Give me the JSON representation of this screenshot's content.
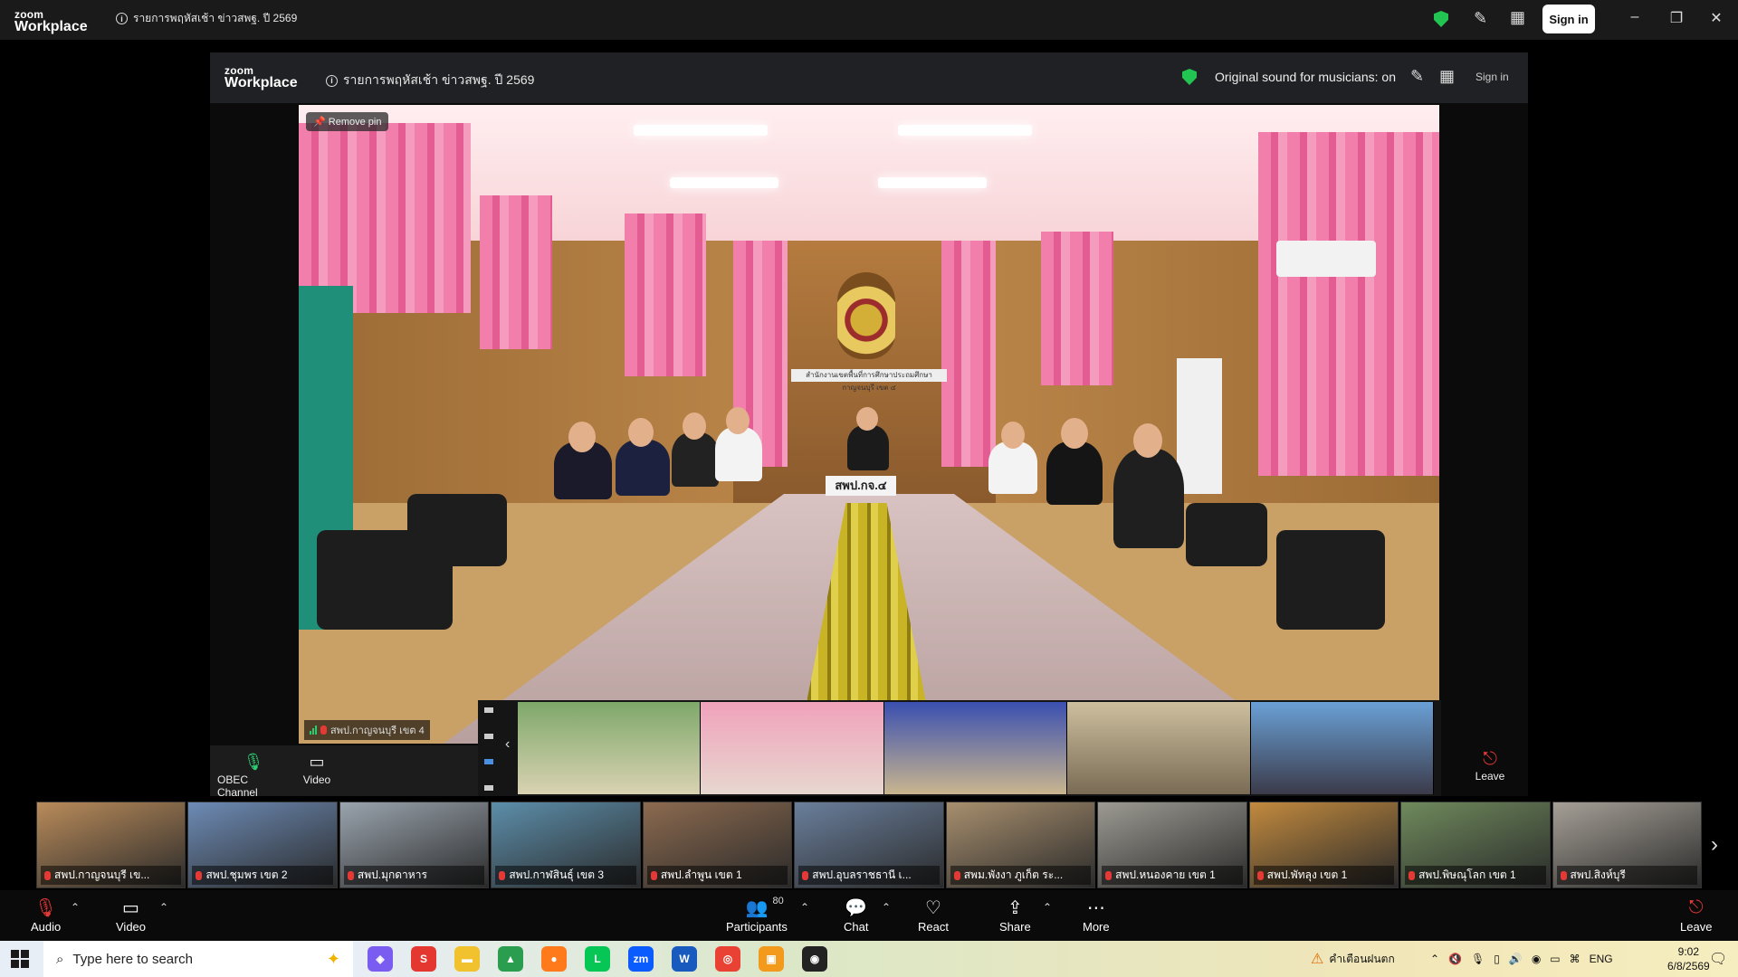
{
  "app": {
    "brand_top": "zoom",
    "brand_bottom": "Workplace"
  },
  "meeting": {
    "title": "รายการพฤหัสเช้า ข่าวสพฐ. ปี 2569"
  },
  "window": {
    "sign_in": "Sign in"
  },
  "shared_screen": {
    "original_sound": "Original sound for musicians: on",
    "sign_in": "Sign in",
    "remove_pin": "Remove pin",
    "video_name": "สพป.กาญจนบุรี เขต 4",
    "room_sign": "สำนักงานเขตพื้นที่การศึกษาประถมศึกษากาญจนบุรี เขต ๔",
    "nameplate": "สพป.กจ.๔",
    "inner_audio_label": "OBEC Channel",
    "inner_video_label": "Video",
    "inner_leave_label": "Leave"
  },
  "gallery": {
    "tiles": [
      {
        "name": "สพป.กาญจนบุรี เข...",
        "bg": "#b98b5a"
      },
      {
        "name": "สพป.ชุมพร เขต 2",
        "bg": "#6d8bb5"
      },
      {
        "name": "สพป.มุกดาหาร",
        "bg": "#9aa4ae"
      },
      {
        "name": "สพป.กาฬสินธุ์ เขต 3",
        "bg": "#5c8eaa"
      },
      {
        "name": "สพป.ลำพูน เขต 1",
        "bg": "#8c6a4f"
      },
      {
        "name": "สพป.อุบลราชธานี เ...",
        "bg": "#6a7f9c"
      },
      {
        "name": "สพม.พังงา ภูเก็ต ระ...",
        "bg": "#a88f6e"
      },
      {
        "name": "สพป.หนองคาย เขต 1",
        "bg": "#9c9a92"
      },
      {
        "name": "สพป.พัทลุง เขต 1",
        "bg": "#c28a3e"
      },
      {
        "name": "สพป.พิษณุโลก เขต 1",
        "bg": "#6f8a5c"
      },
      {
        "name": "สพป.สิงห์บุรี",
        "bg": "#a59f96"
      }
    ]
  },
  "toolbar": {
    "audio": "Audio",
    "video": "Video",
    "participants": "Participants",
    "participants_count": "80",
    "chat": "Chat",
    "react": "React",
    "share": "Share",
    "more": "More",
    "leave": "Leave"
  },
  "taskbar": {
    "search_placeholder": "Type here to search",
    "weather": "คำเตือนฝนตก",
    "lang": "ENG",
    "time": "9:02",
    "date": "6/8/2569",
    "zoom_app": "zm",
    "word_app": "W"
  },
  "colors": {
    "accent_green": "#23c552",
    "mic_muted": "#e53935",
    "zoom_blue": "#0b5cff"
  }
}
